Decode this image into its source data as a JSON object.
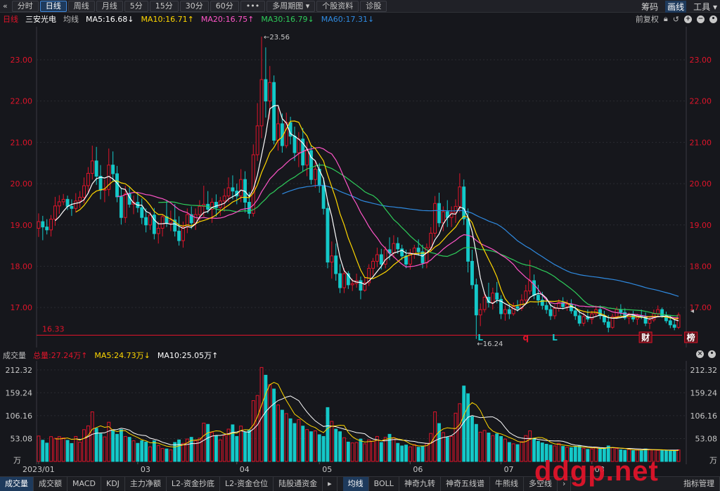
{
  "toolbar": {
    "back_glyph": "«",
    "periods": [
      "分时",
      "日线",
      "周线",
      "月线",
      "5分",
      "15分",
      "30分",
      "60分",
      "•••",
      "多周期图 ▾",
      "个股资料",
      "诊股"
    ],
    "active_period": "日线",
    "right_items": [
      "筹码",
      "画线",
      "工具 ▾"
    ],
    "active_right": "画线"
  },
  "ma_bar": {
    "period_label": "日线",
    "stock_name": "三安光电",
    "line_type": "均线",
    "ma5": "MA5:16.68↓",
    "ma10": "MA10:16.71↑",
    "ma20": "MA20:16.75↑",
    "ma30": "MA30:16.79↓",
    "ma60": "MA60:17.31↓",
    "adjust_label": "前复权",
    "colors": {
      "ma5": "#ffffff",
      "ma10": "#ffd700",
      "ma20": "#ff55c8",
      "ma30": "#2ecc5a",
      "ma60": "#2f8ae0",
      "up": "#e0142a",
      "down": "#14c8c8",
      "axis_text": "#e0142a"
    }
  },
  "volume_bar": {
    "label": "成交量",
    "total": "总量:27.24万↑",
    "ma5": "MA5:24.73万↓",
    "ma10": "MA10:25.05万↑"
  },
  "bottom_tabs": [
    "成交量",
    "成交额",
    "MACD",
    "KDJ",
    "主力净额",
    "L2-资金抄底",
    "L2-资金仓位",
    "陆股通资金",
    "▸",
    "均线",
    "BOLL",
    "神奇九转",
    "神奇五线谱",
    "牛熊线",
    "多空线",
    "›",
    "指标管理"
  ],
  "watermark": "ddgp.net",
  "chart_data": {
    "type": "candlestick",
    "price_axis": {
      "ticks": [
        "23.00",
        "22.00",
        "21.00",
        "20.00",
        "19.00",
        "18.00",
        "17.00"
      ],
      "ylim": [
        16.1,
        23.8
      ]
    },
    "volume_axis": {
      "ticks": [
        "212.32",
        "159.24",
        "106.16",
        "53.08"
      ],
      "unit": "万",
      "ylim": [
        0,
        230
      ]
    },
    "x_ticks": [
      "2023/01",
      "03",
      "04",
      "05",
      "06",
      "07",
      "08"
    ],
    "annotations": {
      "high": "23.56",
      "low": "16.24",
      "last_close_line": "16.33"
    },
    "event_markers": [
      "L",
      "q",
      "L",
      "财",
      "榜"
    ],
    "candles": [
      {
        "o": 18.92,
        "h": 19.28,
        "l": 18.71,
        "c": 19.08,
        "v": 59.0
      },
      {
        "o": 19.08,
        "h": 19.22,
        "l": 18.63,
        "c": 18.95,
        "v": 49.3
      },
      {
        "o": 18.95,
        "h": 19.14,
        "l": 18.77,
        "c": 18.88,
        "v": 42.6
      },
      {
        "o": 18.88,
        "h": 19.24,
        "l": 18.72,
        "c": 19.14,
        "v": 57.6
      },
      {
        "o": 19.14,
        "h": 19.68,
        "l": 18.98,
        "c": 19.46,
        "v": 53.7
      },
      {
        "o": 19.46,
        "h": 19.72,
        "l": 19.27,
        "c": 19.56,
        "v": 57.5
      },
      {
        "o": 19.56,
        "h": 19.75,
        "l": 19.48,
        "c": 19.62,
        "v": 54.6
      },
      {
        "o": 19.62,
        "h": 19.71,
        "l": 19.36,
        "c": 19.45,
        "v": 49.0
      },
      {
        "o": 19.45,
        "h": 19.62,
        "l": 19.22,
        "c": 19.4,
        "v": 41.7
      },
      {
        "o": 19.4,
        "h": 19.77,
        "l": 19.3,
        "c": 19.58,
        "v": 58.0
      },
      {
        "o": 19.58,
        "h": 19.82,
        "l": 19.41,
        "c": 19.67,
        "v": 45.0
      },
      {
        "o": 19.67,
        "h": 20.15,
        "l": 19.52,
        "c": 19.95,
        "v": 73.8
      },
      {
        "o": 19.95,
        "h": 20.4,
        "l": 19.78,
        "c": 20.25,
        "v": 82.6
      },
      {
        "o": 20.25,
        "h": 20.92,
        "l": 20.1,
        "c": 20.55,
        "v": 115.0
      },
      {
        "o": 20.55,
        "h": 20.89,
        "l": 19.97,
        "c": 20.18,
        "v": 77.0
      },
      {
        "o": 20.18,
        "h": 20.45,
        "l": 19.62,
        "c": 19.84,
        "v": 64.0
      },
      {
        "o": 19.84,
        "h": 20.1,
        "l": 19.55,
        "c": 19.86,
        "v": 57.0
      },
      {
        "o": 19.86,
        "h": 20.85,
        "l": 19.7,
        "c": 20.45,
        "v": 91.0
      },
      {
        "o": 20.45,
        "h": 20.78,
        "l": 20.05,
        "c": 20.24,
        "v": 72.0
      },
      {
        "o": 20.24,
        "h": 20.43,
        "l": 19.55,
        "c": 19.68,
        "v": 63.0
      },
      {
        "o": 19.68,
        "h": 19.9,
        "l": 19.01,
        "c": 19.18,
        "v": 74.0
      },
      {
        "o": 19.18,
        "h": 19.95,
        "l": 19.05,
        "c": 19.75,
        "v": 58.0
      },
      {
        "o": 19.75,
        "h": 19.91,
        "l": 19.42,
        "c": 19.5,
        "v": 56.0
      },
      {
        "o": 19.5,
        "h": 19.71,
        "l": 19.26,
        "c": 19.55,
        "v": 48.0
      },
      {
        "o": 19.55,
        "h": 19.8,
        "l": 19.3,
        "c": 19.42,
        "v": 42.0
      },
      {
        "o": 19.42,
        "h": 19.64,
        "l": 19.02,
        "c": 19.18,
        "v": 48.0
      },
      {
        "o": 19.18,
        "h": 19.4,
        "l": 18.82,
        "c": 19.0,
        "v": 45.0
      },
      {
        "o": 19.0,
        "h": 19.32,
        "l": 18.88,
        "c": 19.24,
        "v": 34.0
      },
      {
        "o": 19.24,
        "h": 19.41,
        "l": 18.65,
        "c": 18.79,
        "v": 48.0
      },
      {
        "o": 18.79,
        "h": 19.08,
        "l": 18.55,
        "c": 18.92,
        "v": 37.0
      },
      {
        "o": 18.92,
        "h": 19.26,
        "l": 18.72,
        "c": 19.2,
        "v": 30.0
      },
      {
        "o": 19.2,
        "h": 19.6,
        "l": 18.95,
        "c": 19.05,
        "v": 29.0
      },
      {
        "o": 19.05,
        "h": 19.35,
        "l": 18.85,
        "c": 19.12,
        "v": 27.0
      },
      {
        "o": 19.12,
        "h": 19.51,
        "l": 18.72,
        "c": 18.85,
        "v": 44.0
      },
      {
        "o": 18.85,
        "h": 19.21,
        "l": 18.5,
        "c": 18.62,
        "v": 50.0
      },
      {
        "o": 18.62,
        "h": 19.08,
        "l": 18.45,
        "c": 18.95,
        "v": 42.0
      },
      {
        "o": 18.95,
        "h": 19.4,
        "l": 18.8,
        "c": 19.25,
        "v": 52.0
      },
      {
        "o": 19.25,
        "h": 19.45,
        "l": 18.9,
        "c": 19.05,
        "v": 56.0
      },
      {
        "o": 19.05,
        "h": 19.4,
        "l": 18.88,
        "c": 19.25,
        "v": 48.0
      },
      {
        "o": 19.25,
        "h": 19.6,
        "l": 19.08,
        "c": 19.45,
        "v": 54.0
      },
      {
        "o": 19.45,
        "h": 19.95,
        "l": 19.2,
        "c": 19.5,
        "v": 89.0
      },
      {
        "o": 19.5,
        "h": 19.82,
        "l": 19.28,
        "c": 19.38,
        "v": 86.0
      },
      {
        "o": 19.38,
        "h": 19.65,
        "l": 19.05,
        "c": 19.55,
        "v": 67.0
      },
      {
        "o": 19.55,
        "h": 19.74,
        "l": 19.2,
        "c": 19.42,
        "v": 59.0
      },
      {
        "o": 19.42,
        "h": 19.68,
        "l": 19.22,
        "c": 19.58,
        "v": 50.0
      },
      {
        "o": 19.58,
        "h": 19.88,
        "l": 19.32,
        "c": 19.7,
        "v": 60.0
      },
      {
        "o": 19.7,
        "h": 20.15,
        "l": 19.55,
        "c": 19.9,
        "v": 75.0
      },
      {
        "o": 19.9,
        "h": 20.2,
        "l": 19.62,
        "c": 19.82,
        "v": 85.0
      },
      {
        "o": 19.82,
        "h": 20.0,
        "l": 19.5,
        "c": 19.7,
        "v": 58.0
      },
      {
        "o": 19.7,
        "h": 20.35,
        "l": 19.55,
        "c": 20.1,
        "v": 82.0
      },
      {
        "o": 20.1,
        "h": 20.3,
        "l": 19.3,
        "c": 19.55,
        "v": 68.0
      },
      {
        "o": 19.55,
        "h": 19.8,
        "l": 19.15,
        "c": 19.28,
        "v": 73.0
      },
      {
        "o": 19.28,
        "h": 20.95,
        "l": 19.2,
        "c": 20.7,
        "v": 141.0
      },
      {
        "o": 20.7,
        "h": 21.95,
        "l": 20.55,
        "c": 21.4,
        "v": 153.0
      },
      {
        "o": 21.4,
        "h": 23.56,
        "l": 21.1,
        "c": 22.52,
        "v": 218.0
      },
      {
        "o": 22.52,
        "h": 23.3,
        "l": 21.6,
        "c": 22.0,
        "v": 200.0
      },
      {
        "o": 22.0,
        "h": 22.85,
        "l": 21.55,
        "c": 22.45,
        "v": 178.0
      },
      {
        "o": 22.45,
        "h": 22.62,
        "l": 20.95,
        "c": 21.05,
        "v": 168.0
      },
      {
        "o": 21.05,
        "h": 21.85,
        "l": 20.8,
        "c": 21.45,
        "v": 131.0
      },
      {
        "o": 21.45,
        "h": 21.7,
        "l": 20.75,
        "c": 20.92,
        "v": 119.0
      },
      {
        "o": 20.92,
        "h": 21.72,
        "l": 20.86,
        "c": 21.48,
        "v": 111.0
      },
      {
        "o": 21.48,
        "h": 21.62,
        "l": 20.95,
        "c": 21.15,
        "v": 99.0
      },
      {
        "o": 21.15,
        "h": 21.38,
        "l": 20.55,
        "c": 20.75,
        "v": 88.0
      },
      {
        "o": 20.75,
        "h": 21.25,
        "l": 20.4,
        "c": 21.08,
        "v": 97.0
      },
      {
        "o": 21.08,
        "h": 21.35,
        "l": 20.3,
        "c": 20.45,
        "v": 82.0
      },
      {
        "o": 20.45,
        "h": 21.02,
        "l": 20.18,
        "c": 20.8,
        "v": 74.0
      },
      {
        "o": 20.8,
        "h": 20.92,
        "l": 19.98,
        "c": 20.1,
        "v": 69.0
      },
      {
        "o": 20.1,
        "h": 20.55,
        "l": 19.9,
        "c": 20.35,
        "v": 71.0
      },
      {
        "o": 20.35,
        "h": 20.5,
        "l": 19.78,
        "c": 19.95,
        "v": 62.0
      },
      {
        "o": 19.95,
        "h": 20.15,
        "l": 19.25,
        "c": 19.4,
        "v": 58.0
      },
      {
        "o": 19.4,
        "h": 19.55,
        "l": 17.95,
        "c": 18.1,
        "v": 125.0
      },
      {
        "o": 18.1,
        "h": 18.6,
        "l": 17.7,
        "c": 18.25,
        "v": 93.0
      },
      {
        "o": 18.25,
        "h": 18.55,
        "l": 17.65,
        "c": 17.82,
        "v": 75.0
      },
      {
        "o": 17.82,
        "h": 18.05,
        "l": 17.35,
        "c": 17.48,
        "v": 69.0
      },
      {
        "o": 17.48,
        "h": 17.95,
        "l": 17.35,
        "c": 17.82,
        "v": 55.0
      },
      {
        "o": 17.82,
        "h": 17.88,
        "l": 17.45,
        "c": 17.55,
        "v": 45.0
      },
      {
        "o": 17.55,
        "h": 17.7,
        "l": 17.4,
        "c": 17.58,
        "v": 43.0
      },
      {
        "o": 17.58,
        "h": 17.82,
        "l": 17.48,
        "c": 17.65,
        "v": 44.0
      },
      {
        "o": 17.65,
        "h": 17.75,
        "l": 17.2,
        "c": 17.42,
        "v": 52.0
      },
      {
        "o": 17.42,
        "h": 17.72,
        "l": 17.38,
        "c": 17.6,
        "v": 41.0
      },
      {
        "o": 17.6,
        "h": 18.05,
        "l": 17.52,
        "c": 17.95,
        "v": 50.0
      },
      {
        "o": 17.95,
        "h": 18.2,
        "l": 17.78,
        "c": 18.12,
        "v": 47.0
      },
      {
        "o": 18.12,
        "h": 18.45,
        "l": 17.98,
        "c": 18.28,
        "v": 58.0
      },
      {
        "o": 18.28,
        "h": 18.42,
        "l": 17.92,
        "c": 18.05,
        "v": 44.0
      },
      {
        "o": 18.05,
        "h": 18.48,
        "l": 17.95,
        "c": 18.4,
        "v": 56.0
      },
      {
        "o": 18.4,
        "h": 18.7,
        "l": 18.15,
        "c": 18.32,
        "v": 63.0
      },
      {
        "o": 18.32,
        "h": 18.75,
        "l": 18.2,
        "c": 18.55,
        "v": 55.0
      },
      {
        "o": 18.55,
        "h": 18.7,
        "l": 18.3,
        "c": 18.42,
        "v": 42.0
      },
      {
        "o": 18.42,
        "h": 18.52,
        "l": 18.15,
        "c": 18.25,
        "v": 36.0
      },
      {
        "o": 18.25,
        "h": 18.4,
        "l": 17.95,
        "c": 18.05,
        "v": 38.0
      },
      {
        "o": 18.05,
        "h": 18.42,
        "l": 17.92,
        "c": 18.3,
        "v": 34.0
      },
      {
        "o": 18.3,
        "h": 18.52,
        "l": 18.18,
        "c": 18.44,
        "v": 39.0
      },
      {
        "o": 18.44,
        "h": 18.65,
        "l": 18.25,
        "c": 18.35,
        "v": 33.0
      },
      {
        "o": 18.35,
        "h": 18.52,
        "l": 17.95,
        "c": 18.08,
        "v": 35.0
      },
      {
        "o": 18.08,
        "h": 18.55,
        "l": 17.95,
        "c": 18.45,
        "v": 42.0
      },
      {
        "o": 18.45,
        "h": 18.95,
        "l": 18.35,
        "c": 18.8,
        "v": 65.0
      },
      {
        "o": 18.8,
        "h": 19.7,
        "l": 18.7,
        "c": 19.52,
        "v": 115.0
      },
      {
        "o": 19.52,
        "h": 19.78,
        "l": 18.95,
        "c": 19.05,
        "v": 88.0
      },
      {
        "o": 19.05,
        "h": 19.45,
        "l": 18.85,
        "c": 19.32,
        "v": 67.0
      },
      {
        "o": 19.32,
        "h": 19.6,
        "l": 18.95,
        "c": 19.18,
        "v": 56.0
      },
      {
        "o": 19.18,
        "h": 19.45,
        "l": 18.95,
        "c": 19.3,
        "v": 58.0
      },
      {
        "o": 19.3,
        "h": 19.62,
        "l": 19.05,
        "c": 19.45,
        "v": 112.0
      },
      {
        "o": 19.45,
        "h": 20.25,
        "l": 19.3,
        "c": 19.92,
        "v": 134.0
      },
      {
        "o": 19.92,
        "h": 20.1,
        "l": 19.0,
        "c": 19.15,
        "v": 175.0
      },
      {
        "o": 19.15,
        "h": 19.4,
        "l": 17.85,
        "c": 18.12,
        "v": 157.0
      },
      {
        "o": 18.12,
        "h": 18.4,
        "l": 17.45,
        "c": 17.55,
        "v": 104.0
      },
      {
        "o": 17.55,
        "h": 17.7,
        "l": 16.24,
        "c": 16.82,
        "v": 86.0
      },
      {
        "o": 16.82,
        "h": 17.1,
        "l": 16.55,
        "c": 16.95,
        "v": 68.0
      },
      {
        "o": 16.95,
        "h": 17.38,
        "l": 16.88,
        "c": 17.25,
        "v": 72.0
      },
      {
        "o": 17.25,
        "h": 17.6,
        "l": 17.0,
        "c": 17.12,
        "v": 66.0
      },
      {
        "o": 17.12,
        "h": 17.48,
        "l": 16.95,
        "c": 17.35,
        "v": 60.0
      },
      {
        "o": 17.35,
        "h": 17.62,
        "l": 17.1,
        "c": 17.2,
        "v": 64.0
      },
      {
        "o": 17.2,
        "h": 17.3,
        "l": 16.72,
        "c": 16.85,
        "v": 58.0
      },
      {
        "o": 16.85,
        "h": 17.05,
        "l": 16.68,
        "c": 16.95,
        "v": 52.0
      },
      {
        "o": 16.95,
        "h": 17.08,
        "l": 16.72,
        "c": 16.85,
        "v": 44.0
      },
      {
        "o": 16.85,
        "h": 17.12,
        "l": 16.8,
        "c": 17.02,
        "v": 41.0
      },
      {
        "o": 17.02,
        "h": 17.18,
        "l": 16.9,
        "c": 16.98,
        "v": 39.0
      },
      {
        "o": 16.98,
        "h": 17.32,
        "l": 16.92,
        "c": 17.18,
        "v": 46.0
      },
      {
        "o": 17.18,
        "h": 17.55,
        "l": 17.1,
        "c": 17.4,
        "v": 60.0
      },
      {
        "o": 17.4,
        "h": 18.15,
        "l": 17.32,
        "c": 17.65,
        "v": 71.0
      },
      {
        "o": 17.65,
        "h": 17.8,
        "l": 17.2,
        "c": 17.3,
        "v": 54.0
      },
      {
        "o": 17.3,
        "h": 17.55,
        "l": 17.05,
        "c": 17.18,
        "v": 47.0
      },
      {
        "o": 17.18,
        "h": 17.38,
        "l": 16.95,
        "c": 17.05,
        "v": 43.0
      },
      {
        "o": 17.05,
        "h": 17.22,
        "l": 16.85,
        "c": 16.95,
        "v": 40.0
      },
      {
        "o": 16.95,
        "h": 17.1,
        "l": 16.7,
        "c": 16.8,
        "v": 38.0
      },
      {
        "o": 16.8,
        "h": 17.05,
        "l": 16.72,
        "c": 16.98,
        "v": 36.0
      },
      {
        "o": 16.98,
        "h": 17.2,
        "l": 16.9,
        "c": 17.12,
        "v": 42.0
      },
      {
        "o": 17.12,
        "h": 17.25,
        "l": 16.95,
        "c": 17.02,
        "v": 35.0
      },
      {
        "o": 17.02,
        "h": 17.18,
        "l": 16.92,
        "c": 17.08,
        "v": 33.0
      },
      {
        "o": 17.08,
        "h": 17.2,
        "l": 16.85,
        "c": 16.92,
        "v": 32.0
      },
      {
        "o": 16.92,
        "h": 17.05,
        "l": 16.7,
        "c": 16.8,
        "v": 34.0
      },
      {
        "o": 16.8,
        "h": 16.95,
        "l": 16.55,
        "c": 16.62,
        "v": 37.0
      },
      {
        "o": 16.62,
        "h": 16.88,
        "l": 16.55,
        "c": 16.78,
        "v": 30.0
      },
      {
        "o": 16.78,
        "h": 16.95,
        "l": 16.65,
        "c": 16.72,
        "v": 28.0
      },
      {
        "o": 16.72,
        "h": 16.92,
        "l": 16.6,
        "c": 16.85,
        "v": 29.0
      },
      {
        "o": 16.85,
        "h": 17.05,
        "l": 16.78,
        "c": 16.95,
        "v": 33.0
      },
      {
        "o": 16.95,
        "h": 17.05,
        "l": 16.72,
        "c": 16.8,
        "v": 31.0
      },
      {
        "o": 16.8,
        "h": 16.92,
        "l": 16.58,
        "c": 16.65,
        "v": 30.0
      },
      {
        "o": 16.65,
        "h": 16.82,
        "l": 16.4,
        "c": 16.52,
        "v": 36.0
      },
      {
        "o": 16.52,
        "h": 16.85,
        "l": 16.48,
        "c": 16.78,
        "v": 32.0
      },
      {
        "o": 16.78,
        "h": 17.02,
        "l": 16.72,
        "c": 16.95,
        "v": 30.0
      },
      {
        "o": 16.95,
        "h": 17.08,
        "l": 16.8,
        "c": 16.88,
        "v": 27.0
      },
      {
        "o": 16.88,
        "h": 16.98,
        "l": 16.7,
        "c": 16.75,
        "v": 26.0
      },
      {
        "o": 16.75,
        "h": 16.88,
        "l": 16.6,
        "c": 16.82,
        "v": 28.0
      },
      {
        "o": 16.82,
        "h": 16.92,
        "l": 16.65,
        "c": 16.72,
        "v": 25.0
      },
      {
        "o": 16.72,
        "h": 16.85,
        "l": 16.58,
        "c": 16.8,
        "v": 27.0
      },
      {
        "o": 16.8,
        "h": 16.95,
        "l": 16.72,
        "c": 16.78,
        "v": 26.0
      },
      {
        "o": 16.78,
        "h": 16.88,
        "l": 16.55,
        "c": 16.62,
        "v": 29.0
      },
      {
        "o": 16.62,
        "h": 16.78,
        "l": 16.48,
        "c": 16.7,
        "v": 28.0
      },
      {
        "o": 16.7,
        "h": 16.95,
        "l": 16.65,
        "c": 16.85,
        "v": 27.0
      },
      {
        "o": 16.85,
        "h": 17.05,
        "l": 16.8,
        "c": 16.95,
        "v": 26.0
      },
      {
        "o": 16.95,
        "h": 17.0,
        "l": 16.75,
        "c": 16.8,
        "v": 25.0
      },
      {
        "o": 16.8,
        "h": 16.9,
        "l": 16.62,
        "c": 16.68,
        "v": 25.0
      },
      {
        "o": 16.68,
        "h": 16.82,
        "l": 16.5,
        "c": 16.58,
        "v": 24.0
      },
      {
        "o": 16.58,
        "h": 16.7,
        "l": 16.45,
        "c": 16.52,
        "v": 26.0
      },
      {
        "o": 16.52,
        "h": 16.88,
        "l": 16.48,
        "c": 16.82,
        "v": 27.0
      }
    ]
  }
}
